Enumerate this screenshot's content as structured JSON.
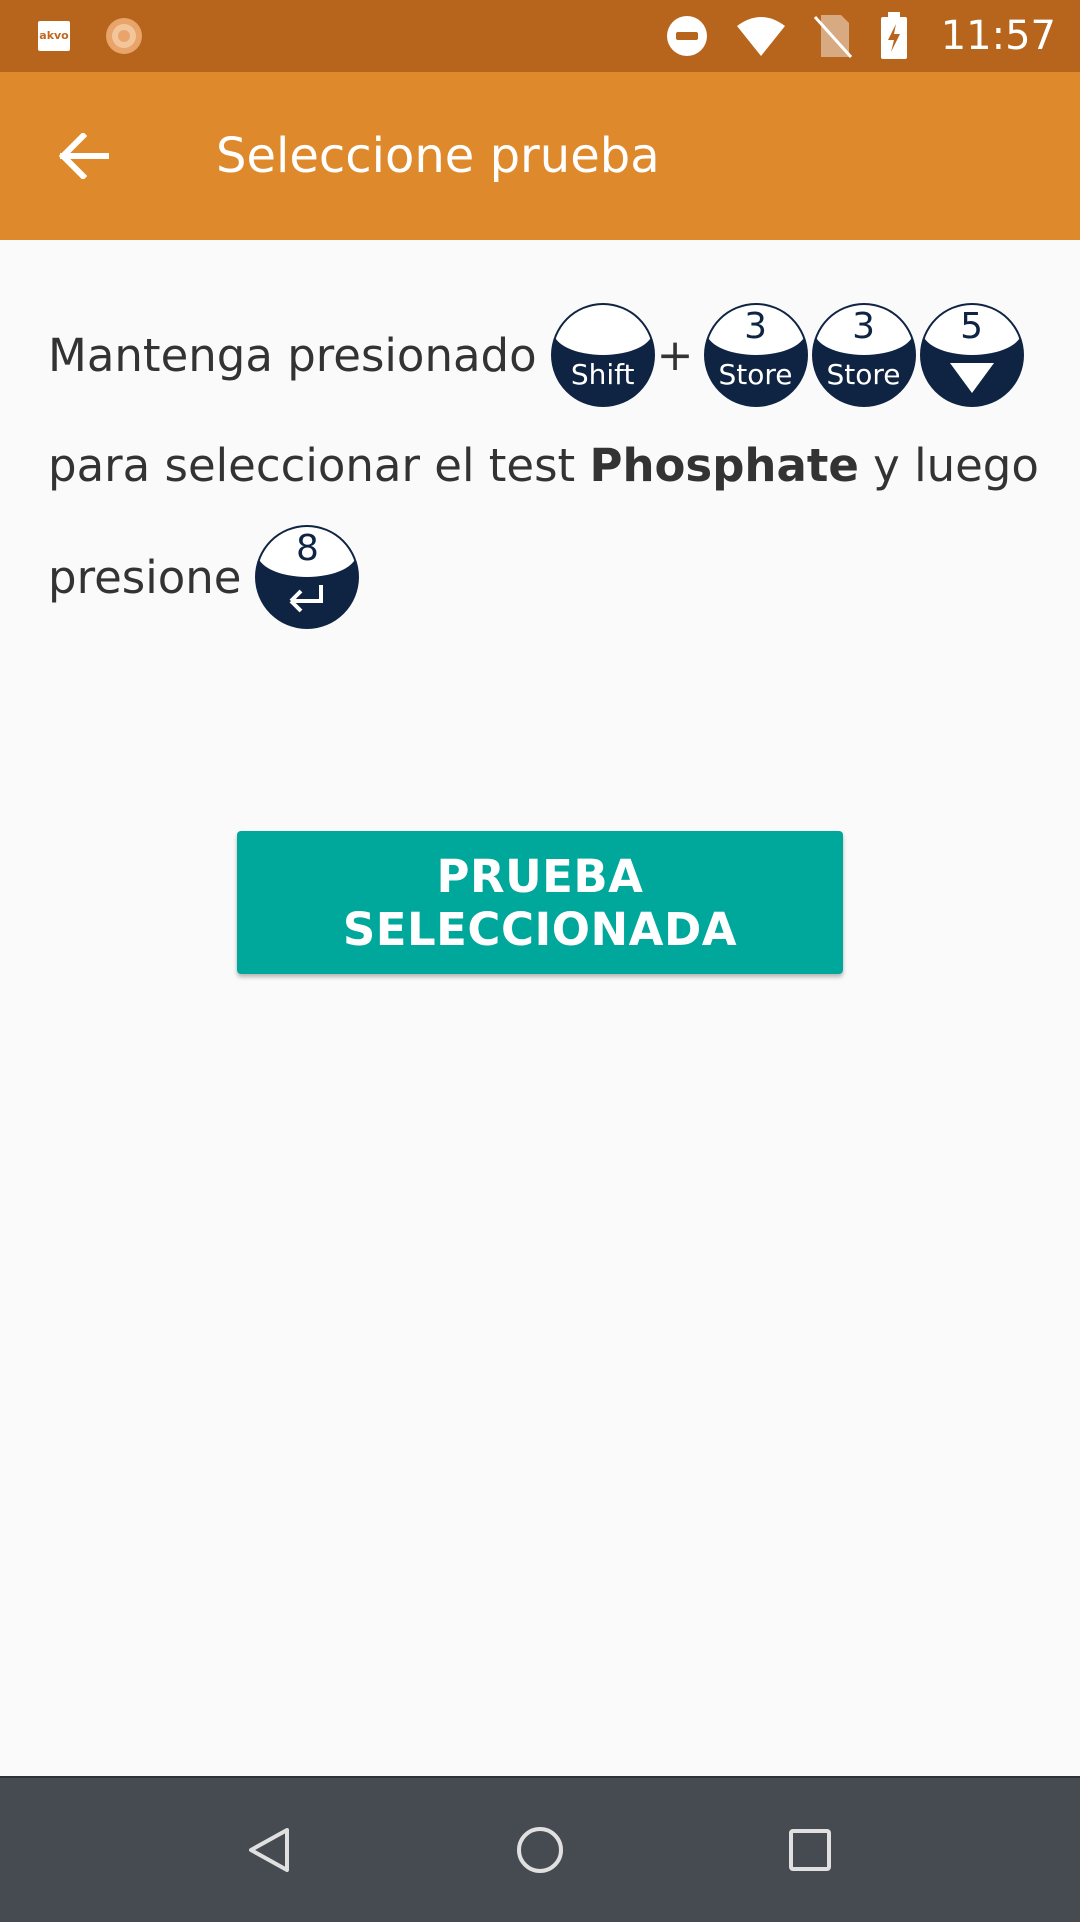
{
  "status_bar": {
    "time": "11:57",
    "icons": [
      "akvo-app-icon",
      "sun-app-icon",
      "do-not-disturb-icon",
      "wifi-icon",
      "no-sim-icon",
      "battery-charging-icon"
    ],
    "akvo_label": "akvo"
  },
  "app_bar": {
    "title": "Seleccione prueba",
    "back_icon": "arrow-back-icon"
  },
  "instructions": {
    "line1_prefix": "Mantenga presionado",
    "plus": "+",
    "line2_prefix": "para seleccionar el test ",
    "test_name": "Phosphate",
    "line2_suffix": " y luego",
    "line3_prefix": "presione"
  },
  "keys": {
    "shift": {
      "number": "",
      "label": "Shift"
    },
    "store1": {
      "number": "3",
      "label": "Store"
    },
    "store2": {
      "number": "3",
      "label": "Store"
    },
    "down": {
      "number": "5",
      "label": "down-triangle-icon"
    },
    "enter": {
      "number": "8",
      "label": "enter-arrow-icon"
    }
  },
  "button": {
    "label": "PRUEBA SELECCIONADA"
  },
  "nav_bar": {
    "back_icon": "nav-back-icon",
    "home_icon": "nav-home-icon",
    "recents_icon": "nav-recents-icon"
  },
  "colors": {
    "status_bar": "#b7651d",
    "app_bar": "#de892b",
    "button": "#00a79b",
    "key_dark": "#0f2442",
    "nav_bar": "#454b51"
  }
}
